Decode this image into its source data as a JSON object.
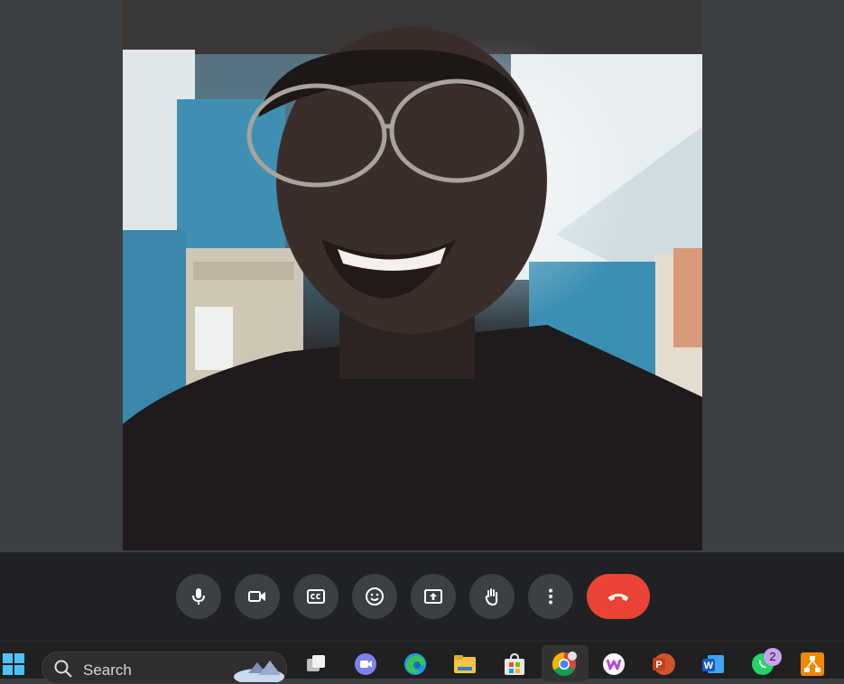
{
  "meeting": {
    "controls": [
      {
        "id": "mic",
        "icon": "microphone-icon"
      },
      {
        "id": "camera",
        "icon": "video-camera-icon"
      },
      {
        "id": "captions",
        "icon": "closed-captions-icon"
      },
      {
        "id": "reactions",
        "icon": "emoji-icon"
      },
      {
        "id": "present",
        "icon": "present-screen-icon"
      },
      {
        "id": "raise-hand",
        "icon": "raise-hand-icon"
      },
      {
        "id": "more",
        "icon": "more-vert-icon"
      },
      {
        "id": "leave",
        "icon": "end-call-icon"
      }
    ],
    "colors": {
      "bar": "#202124",
      "button": "#3c4043",
      "end_call": "#ea4335"
    }
  },
  "taskbar": {
    "search_placeholder": "Search",
    "whatsapp_badge": "2",
    "apps": [
      "windows-start-icon",
      "task-view-icon",
      "teams-icon",
      "edge-icon",
      "file-explorer-icon",
      "microsoft-store-icon",
      "chrome-icon",
      "wps-office-icon",
      "powerpoint-icon",
      "word-icon",
      "whatsapp-icon",
      "drawio-icon"
    ]
  }
}
